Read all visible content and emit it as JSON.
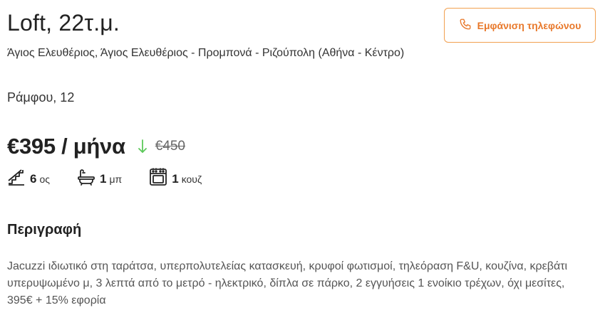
{
  "listing": {
    "title": "Loft, 22τ.μ.",
    "location": "Άγιος Ελευθέριος, Άγιος Ελευθέριος - Προμπονά - Ριζούπολη (Αθήνα - Κέντρο)",
    "address": "Ράμφου, 12"
  },
  "actions": {
    "phone_label": "Εμφάνιση τηλεφώνου",
    "phone_icon": "phone-icon"
  },
  "price": {
    "current": "€395 / μήνα",
    "previous": "€450",
    "trend_icon": "arrow-down-icon",
    "trend_color": "#5cc85a"
  },
  "features": {
    "floor": {
      "value": "6",
      "unit": "ος",
      "icon": "stairs-icon"
    },
    "bathrooms": {
      "value": "1",
      "unit": "μπ",
      "icon": "bathtub-icon"
    },
    "kitchens": {
      "value": "1",
      "unit": "κουζ",
      "icon": "oven-icon"
    }
  },
  "description": {
    "heading": "Περιγραφή",
    "text": "Jacuzzi ιδιωτικό στη ταράτσα, υπερπολυτελείας κατασκευή, κρυφοί φωτισμοί, τηλεόραση F&U, κουζίνα, κρεβάτι υπερυψωμένο μ, 3 λεπτά από το μετρό - ηλεκτρικό, δίπλα σε πάρκο, 2 εγγυήσεις 1 ενοίκιο τρέχων, όχι μεσίτες, 395€ + 15% εφορία"
  },
  "colors": {
    "accent": "#e8782a",
    "accent_border": "#f2a04f"
  }
}
